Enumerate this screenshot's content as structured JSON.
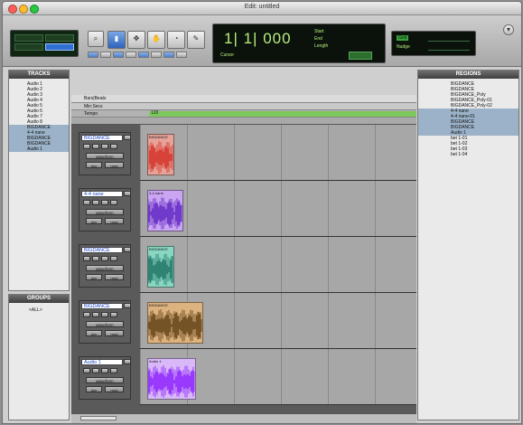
{
  "window": {
    "title": "Edit: untitled"
  },
  "toolbar": {
    "counter_main": "1| 1| 000",
    "counter_start": "Start",
    "counter_end": "End",
    "counter_length": "Length",
    "cursor_label": "Cursor",
    "grid_label": "Grid",
    "nudge_label": "Nudge"
  },
  "panels": {
    "tracks_title": "TRACKS",
    "groups_title": "GROUPS",
    "groups_item": "<ALL>",
    "regions_title": "REGIONS"
  },
  "tracks_list": [
    {
      "label": "Audio 1"
    },
    {
      "label": "Audio 2"
    },
    {
      "label": "Audio 3"
    },
    {
      "label": "Audio 4"
    },
    {
      "label": "Audio 5"
    },
    {
      "label": "Audio 6"
    },
    {
      "label": "Audio 7"
    },
    {
      "label": "Audio 8"
    },
    {
      "label": "BIGDANCE"
    },
    {
      "label": "4-4 nane"
    },
    {
      "label": "BIGDANCE"
    },
    {
      "label": "BIGDANCE"
    },
    {
      "label": "Audio 1"
    }
  ],
  "ruler": {
    "bars_beats": "Bars|Beats",
    "min_secs": "Min:Secs",
    "tempo": "Tempo",
    "marker": "120"
  },
  "tracks": [
    {
      "name": "BIGDANCE",
      "view": "waveform",
      "btn": "dyn",
      "vol": "read",
      "region": "BIGDANCE",
      "color": "#e6a39a",
      "wave": "#d42b20"
    },
    {
      "name": "4-4 nane",
      "view": "waveform",
      "btn": "dyn",
      "vol": "read",
      "region": "4-4 nane",
      "color": "#c9a5f2",
      "wave": "#5b1fbf"
    },
    {
      "name": "BIGDANCE",
      "view": "waveform",
      "btn": "dyn",
      "vol": "read",
      "region": "BIGDANCE",
      "color": "#89d7c2",
      "wave": "#1a6e5f"
    },
    {
      "name": "BIGDANCE",
      "view": "waveform",
      "btn": "dyn",
      "vol": "read",
      "region": "BIGDANCE",
      "color": "#dcb27f",
      "wave": "#5a3b10"
    },
    {
      "name": "Audio 1",
      "view": "waveform",
      "btn": "dyn",
      "vol": "read",
      "region": "Audio 1",
      "color": "#d8b8f7",
      "wave": "#8a19ff"
    }
  ],
  "regions_list": [
    {
      "label": "BIGDANCE"
    },
    {
      "label": "BIGDANCE"
    },
    {
      "label": "BIGDANCE_Poly"
    },
    {
      "label": "BIGDANCE_Poly-01"
    },
    {
      "label": "BIGDANCE_Poly-02"
    },
    {
      "label": "4-4 nane"
    },
    {
      "label": "4-4 nane-01"
    },
    {
      "label": "BIGDANCE"
    },
    {
      "label": "BIGDANCE"
    },
    {
      "label": "Audio 1"
    },
    {
      "label": "bet 1-01"
    },
    {
      "label": "bet 1-02"
    },
    {
      "label": "bet 1-03"
    },
    {
      "label": "bet 1-04"
    }
  ],
  "colors": {
    "window_bg": "#cfcfcf",
    "lcd_text": "#b6f07c",
    "select_blue": "#2d63bb"
  }
}
